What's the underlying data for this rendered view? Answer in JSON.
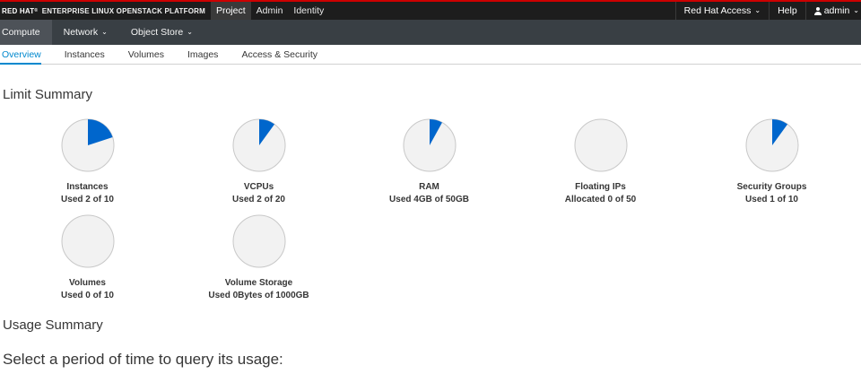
{
  "brand": {
    "name": "RED HAT",
    "product": "ENTERPRISE LINUX OPENSTACK PLATFORM"
  },
  "topnav": [
    {
      "label": "Project",
      "active": true
    },
    {
      "label": "Admin",
      "active": false
    },
    {
      "label": "Identity",
      "active": false
    }
  ],
  "topright": {
    "support": "Red Hat Access",
    "help": "Help",
    "user": "admin"
  },
  "secondnav": [
    {
      "label": "Compute",
      "active": true,
      "dropdown": false
    },
    {
      "label": "Network",
      "active": false,
      "dropdown": true
    },
    {
      "label": "Object Store",
      "active": false,
      "dropdown": true
    }
  ],
  "tabs": [
    {
      "label": "Overview",
      "active": true
    },
    {
      "label": "Instances",
      "active": false
    },
    {
      "label": "Volumes",
      "active": false
    },
    {
      "label": "Images",
      "active": false
    },
    {
      "label": "Access & Security",
      "active": false
    }
  ],
  "limit_summary": {
    "heading": "Limit Summary",
    "charts": [
      {
        "title": "Instances",
        "used_text": "Used 2 of 10",
        "used": 2,
        "total": 10
      },
      {
        "title": "VCPUs",
        "used_text": "Used 2 of 20",
        "used": 2,
        "total": 20
      },
      {
        "title": "RAM",
        "used_text": "Used 4GB of 50GB",
        "used": 4,
        "total": 50
      },
      {
        "title": "Floating IPs",
        "used_text": "Allocated 0 of 50",
        "used": 0,
        "total": 50
      },
      {
        "title": "Security Groups",
        "used_text": "Used 1 of 10",
        "used": 1,
        "total": 10
      },
      {
        "title": "Volumes",
        "used_text": "Used 0 of 10",
        "used": 0,
        "total": 10
      },
      {
        "title": "Volume Storage",
        "used_text": "Used 0Bytes of 1000GB",
        "used": 0,
        "total": 1000
      }
    ]
  },
  "usage_summary": {
    "heading": "Usage Summary",
    "prompt": "Select a period of time to query its usage:"
  },
  "colors": {
    "used": "#0066cc",
    "free": "#f2f2f2",
    "border": "#c8c8c8",
    "accent": "#0088ce"
  }
}
